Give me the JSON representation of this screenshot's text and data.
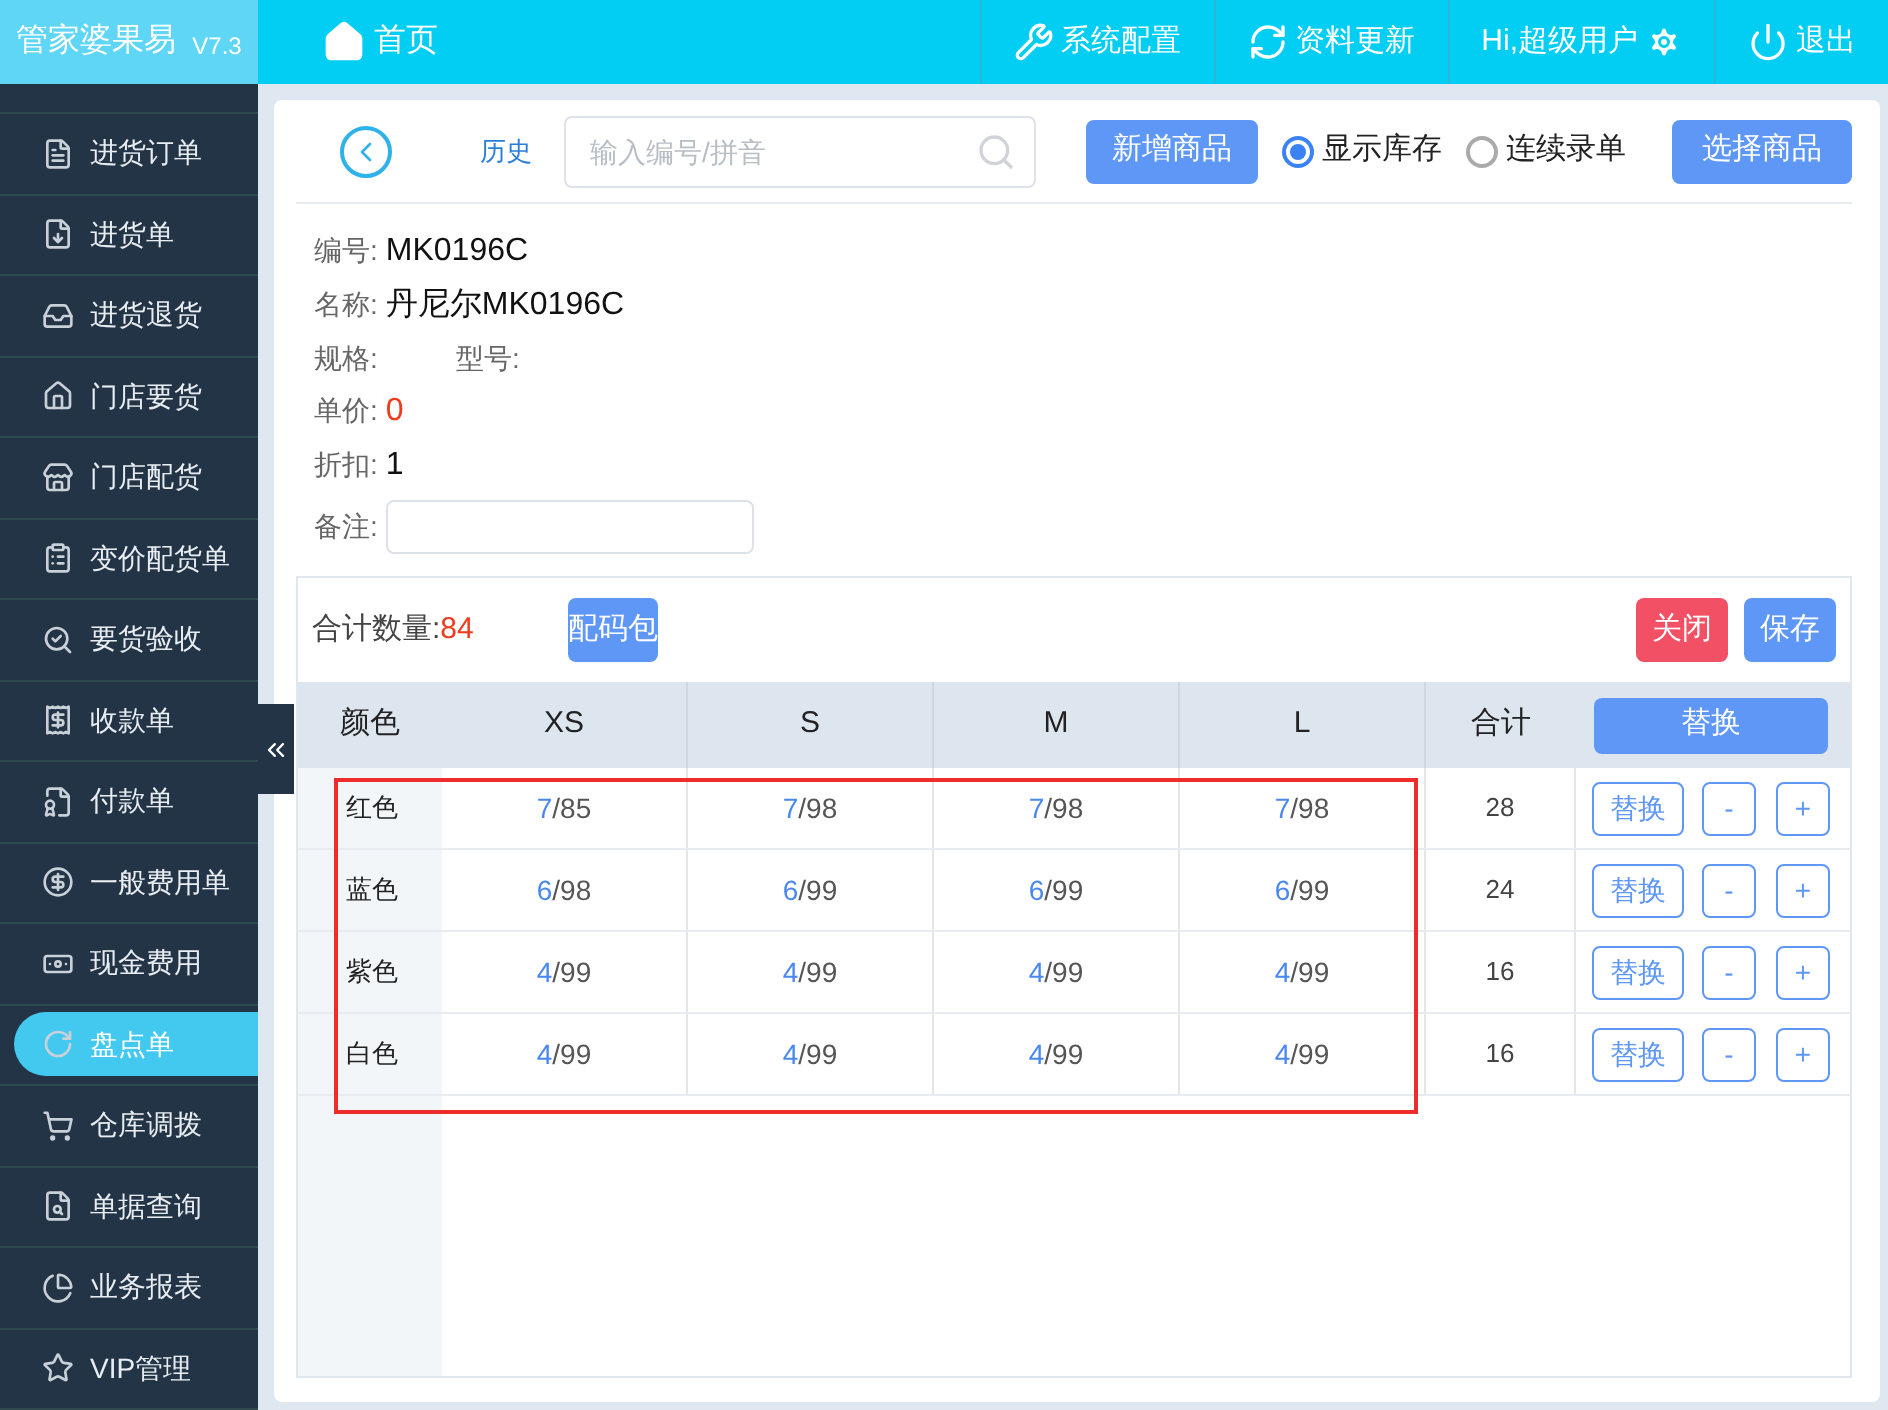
{
  "app": {
    "name": "管家婆果易",
    "version": "V7.3"
  },
  "topnav": [
    {
      "kind": "home",
      "label": "首页"
    },
    {
      "kind": "tools",
      "label": "系统配置"
    },
    {
      "kind": "refresh",
      "label": "资料更新"
    },
    {
      "kind": "user",
      "label": "Hi,超级用户"
    },
    {
      "kind": "logout",
      "label": "退出"
    }
  ],
  "sidebar": {
    "items": [
      {
        "kind": "order",
        "label": "进货订单",
        "selected": false
      },
      {
        "kind": "doc",
        "label": "进货单",
        "selected": false
      },
      {
        "kind": "inbox",
        "label": "进货退货",
        "selected": false
      },
      {
        "kind": "store",
        "label": "门店要货",
        "selected": false
      },
      {
        "kind": "shop",
        "label": "门店配货",
        "selected": false
      },
      {
        "kind": "clipboard",
        "label": "变价配货单",
        "selected": false
      },
      {
        "kind": "search",
        "label": "要货验收",
        "selected": false
      },
      {
        "kind": "receipt",
        "label": "收款单",
        "selected": false
      },
      {
        "kind": "pay",
        "label": "付款单",
        "selected": false
      },
      {
        "kind": "yen",
        "label": "一般费用单",
        "selected": false
      },
      {
        "kind": "bag",
        "label": "现金费用",
        "selected": false
      },
      {
        "kind": "cycle",
        "label": "盘点单",
        "selected": true
      },
      {
        "kind": "cart",
        "label": "仓库调拨",
        "selected": false
      },
      {
        "kind": "query",
        "label": "单据查询",
        "selected": false
      },
      {
        "kind": "pie",
        "label": "业务报表",
        "selected": false
      },
      {
        "kind": "star",
        "label": "VIP管理",
        "selected": false
      }
    ]
  },
  "toolbar": {
    "history": "历史",
    "search_placeholder": "输入编号/拼音",
    "add_button": "新增商品",
    "radios": [
      {
        "label": "显示库存",
        "selected": true
      },
      {
        "label": "连续录单",
        "selected": false
      }
    ],
    "select_button": "选择商品"
  },
  "info": [
    {
      "label": "编号:",
      "value": "MK0196C"
    },
    {
      "label": "名称:",
      "value": "丹尼尔MK0196C"
    }
  ],
  "spec": {
    "label": "规格:",
    "model_label": "型号:"
  },
  "price": {
    "label": "单价:",
    "value": "0"
  },
  "discount": {
    "label": "折扣:",
    "value": "1"
  },
  "note": {
    "label": "备注:"
  },
  "summary": {
    "label": "合计数量:",
    "value": "84",
    "pack_button": "配码包",
    "close_button": "关闭",
    "save_button": "保存"
  },
  "table": {
    "columns": [
      "颜色",
      "XS",
      "S",
      "M",
      "L",
      "合计"
    ],
    "header_button": "替换",
    "rows": [
      {
        "cells": [
          {
            "kind": "label",
            "text": "红色"
          },
          {
            "kind": "qty",
            "qty": "7",
            "stock": "/85"
          },
          {
            "kind": "qty",
            "qty": "7",
            "stock": "/98"
          },
          {
            "kind": "qty",
            "qty": "7",
            "stock": "/98"
          },
          {
            "kind": "qty",
            "qty": "7",
            "stock": "/98"
          },
          {
            "kind": "total",
            "text": "28"
          }
        ],
        "replace": "替换",
        "minus": "-",
        "plus": "+"
      },
      {
        "cells": [
          {
            "kind": "label",
            "text": "蓝色"
          },
          {
            "kind": "qty",
            "qty": "6",
            "stock": "/98"
          },
          {
            "kind": "qty",
            "qty": "6",
            "stock": "/99"
          },
          {
            "kind": "qty",
            "qty": "6",
            "stock": "/99"
          },
          {
            "kind": "qty",
            "qty": "6",
            "stock": "/99"
          },
          {
            "kind": "total",
            "text": "24"
          }
        ],
        "replace": "替换",
        "minus": "-",
        "plus": "+"
      },
      {
        "cells": [
          {
            "kind": "label",
            "text": "紫色"
          },
          {
            "kind": "qty",
            "qty": "4",
            "stock": "/99"
          },
          {
            "kind": "qty",
            "qty": "4",
            "stock": "/99"
          },
          {
            "kind": "qty",
            "qty": "4",
            "stock": "/99"
          },
          {
            "kind": "qty",
            "qty": "4",
            "stock": "/99"
          },
          {
            "kind": "total",
            "text": "16"
          }
        ],
        "replace": "替换",
        "minus": "-",
        "plus": "+"
      },
      {
        "cells": [
          {
            "kind": "label",
            "text": "白色"
          },
          {
            "kind": "qty",
            "qty": "4",
            "stock": "/99"
          },
          {
            "kind": "qty",
            "qty": "4",
            "stock": "/99"
          },
          {
            "kind": "qty",
            "qty": "4",
            "stock": "/99"
          },
          {
            "kind": "qty",
            "qty": "4",
            "stock": "/99"
          },
          {
            "kind": "total",
            "text": "16"
          }
        ],
        "replace": "替换",
        "minus": "-",
        "plus": "+"
      }
    ]
  }
}
